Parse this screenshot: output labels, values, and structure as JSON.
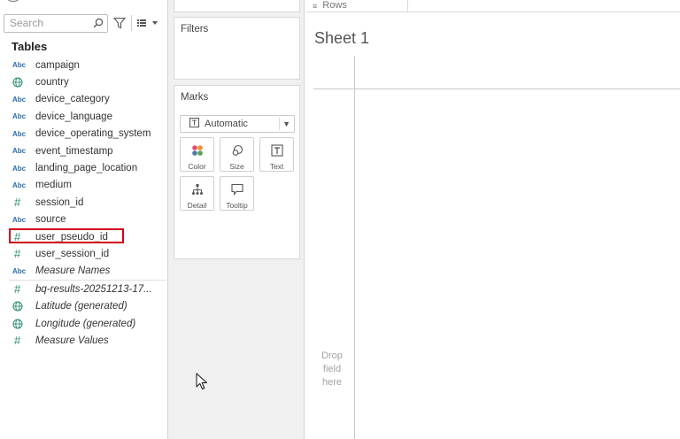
{
  "data_pane": {
    "search": {
      "placeholder": "Search",
      "value": ""
    },
    "tables_heading": "Tables",
    "fields": [
      {
        "type_label": "Abc",
        "type": "dimension",
        "name": "campaign",
        "italic": false
      },
      {
        "type_label": "",
        "type": "geo",
        "name": "country",
        "italic": false
      },
      {
        "type_label": "Abc",
        "type": "dimension",
        "name": "device_category",
        "italic": false
      },
      {
        "type_label": "Abc",
        "type": "dimension",
        "name": "device_language",
        "italic": false
      },
      {
        "type_label": "Abc",
        "type": "dimension",
        "name": "device_operating_system",
        "italic": false
      },
      {
        "type_label": "Abc",
        "type": "dimension",
        "name": "event_timestamp",
        "italic": false
      },
      {
        "type_label": "Abc",
        "type": "dimension",
        "name": "landing_page_location",
        "italic": false
      },
      {
        "type_label": "Abc",
        "type": "dimension",
        "name": "medium",
        "italic": false
      },
      {
        "type_label": "#",
        "type": "number",
        "name": "session_id",
        "italic": false
      },
      {
        "type_label": "Abc",
        "type": "dimension",
        "name": "source",
        "italic": false
      },
      {
        "type_label": "#",
        "type": "number",
        "name": "user_pseudo_id",
        "italic": false,
        "selected": true
      },
      {
        "type_label": "#",
        "type": "number",
        "name": "user_session_id",
        "italic": false
      },
      {
        "type_label": "Abc",
        "type": "dimension",
        "name": "Measure Names",
        "italic": true
      }
    ],
    "measures": [
      {
        "type_label": "#",
        "type": "number",
        "name": "bq-results-20251213-17...",
        "italic": true
      },
      {
        "type_label": "",
        "type": "geo",
        "name": "Latitude (generated)",
        "italic": true
      },
      {
        "type_label": "",
        "type": "geo",
        "name": "Longitude (generated)",
        "italic": true
      },
      {
        "type_label": "#",
        "type": "number",
        "name": "Measure Values",
        "italic": true
      }
    ],
    "highlight_color": "#d0021b"
  },
  "shelves": {
    "filters_title": "Filters",
    "marks_title": "Marks",
    "mark_type": "Automatic",
    "mark_buttons": {
      "color": "Color",
      "size": "Size",
      "text": "Text",
      "detail": "Detail",
      "tooltip": "Tooltip"
    }
  },
  "canvas": {
    "rows_label": "Rows",
    "sheet_title": "Sheet 1",
    "drop_hint": "Drop\nfield\nhere"
  }
}
